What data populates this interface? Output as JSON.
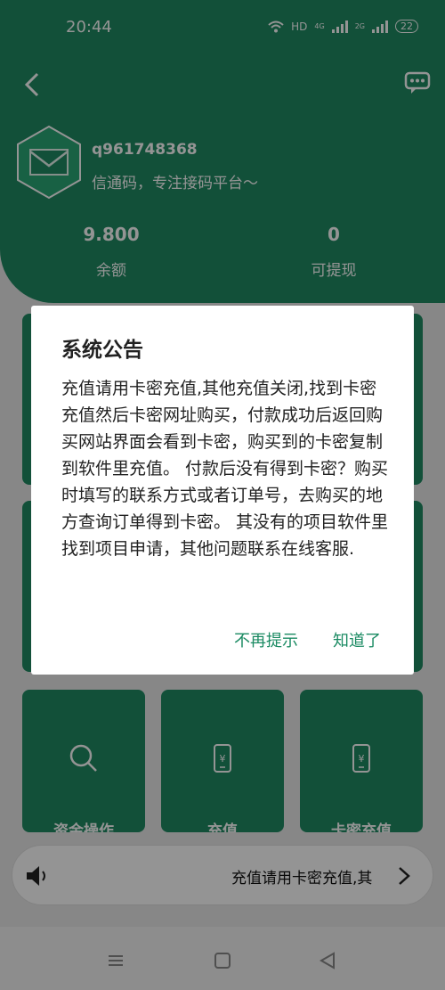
{
  "status": {
    "time": "20:44",
    "network": "HD",
    "signal1": "4G",
    "signal2": "2G",
    "battery": "22"
  },
  "header": {
    "username": "q961748368",
    "slogan": "信通码，专注接码平台～"
  },
  "stats": [
    {
      "value": "9.800",
      "label": "余额"
    },
    {
      "value": "0",
      "label": "可提现"
    }
  ],
  "tiles": [
    {
      "label": "资金操作",
      "icon": "search-icon"
    },
    {
      "label": "充值",
      "icon": "phone-yuan-icon"
    },
    {
      "label": "卡密充值",
      "icon": "phone-yuan-icon"
    }
  ],
  "marquee": {
    "text": "充值请用卡密充值,其"
  },
  "dialog": {
    "title": "系统公告",
    "body": "充值请用卡密充值,其他充值关闭,找到卡密充值然后卡密网址购买，付款成功后返回购买网站界面会看到卡密，购买到的卡密复制到软件里充值。  付款后没有得到卡密？购买时填写的联系方式或者订单号，去购买的地方查询订单得到卡密。  其没有的项目软件里找到项目申请，其他问题联系在线客服.",
    "never_label": "不再提示",
    "ok_label": "知道了"
  },
  "colors": {
    "brand": "#1f8a63",
    "accent_text": "#1a8a62"
  }
}
